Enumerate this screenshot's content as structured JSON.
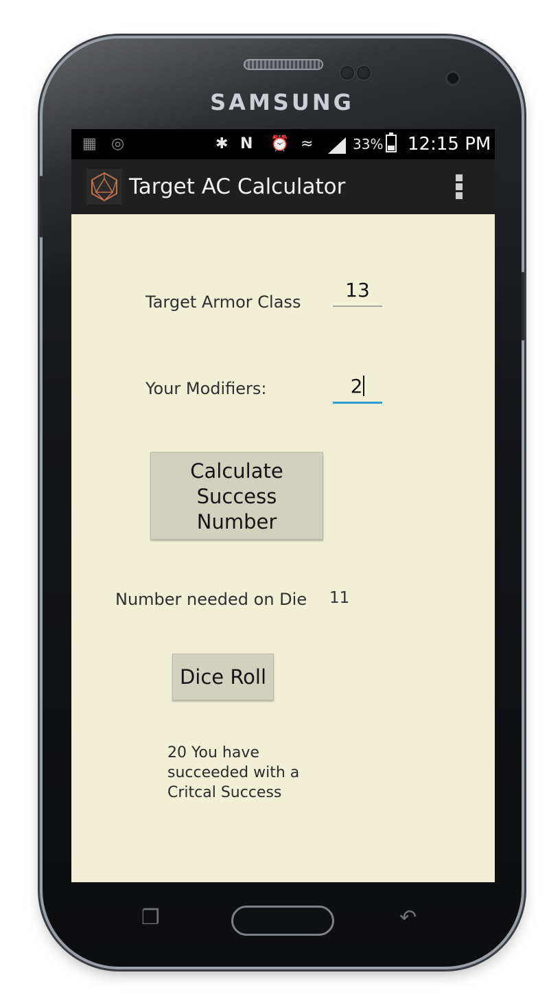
{
  "device": {
    "brand": "SAMSUNG"
  },
  "status_bar": {
    "left_icons": [
      "bbm-icon",
      "ghost-notification-icon"
    ],
    "right_icons": [
      "bluetooth-icon",
      "nfc-icon",
      "alarm-icon",
      "wifi-icon",
      "signal-icon",
      "battery-icon"
    ],
    "battery_percent": "33%",
    "time": "12:15 PM"
  },
  "action_bar": {
    "app_icon": "d20-icon",
    "title": "Target AC Calculator",
    "menu_icon": "overflow-menu-icon"
  },
  "form": {
    "armor_class_label": "Target Armor Class",
    "armor_class_value": "13",
    "modifiers_label": "Your Modifiers:",
    "modifiers_value": "2",
    "calculate_button": [
      "Calculate",
      "Success",
      "Number"
    ],
    "needed_label": "Number needed on Die",
    "needed_value": "11",
    "dice_button": "Dice Roll",
    "result_lines": [
      "20 You have",
      "succeeded with a",
      "Critcal Success"
    ]
  },
  "nav_bar": {
    "icons": [
      "recent-apps-icon",
      "home-button",
      "back-icon"
    ]
  },
  "colors": {
    "screen_bg": "#f1f0d7",
    "button_bg": "#d2d1be",
    "action_bar": "#1f1f1f",
    "focus_underline": "#2c9bd1"
  }
}
